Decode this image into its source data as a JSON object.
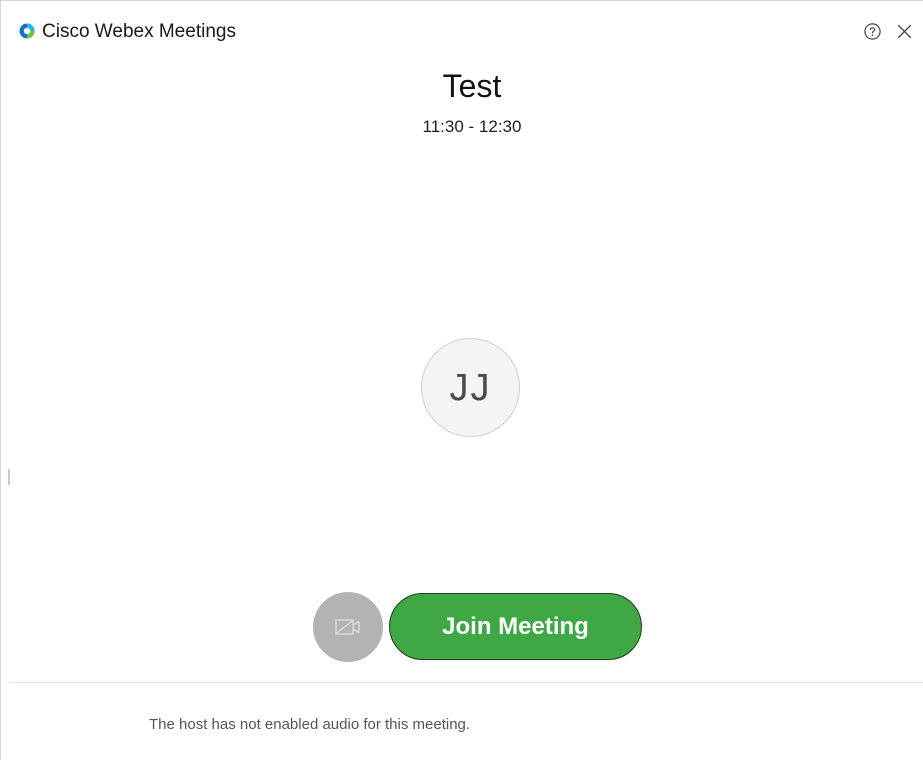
{
  "window": {
    "title": "Cisco Webex Meetings",
    "logo_icon": "webex-logo-icon",
    "help_icon": "help-circle-icon",
    "close_icon": "close-icon"
  },
  "meeting": {
    "title": "Test",
    "time": "11:30 - 12:30"
  },
  "avatar": {
    "initials": "JJ"
  },
  "controls": {
    "video_icon": "video-camera-off-icon",
    "join_label": "Join Meeting"
  },
  "footer": {
    "notice": "The host has not enabled audio for this meeting."
  },
  "colors": {
    "join_green": "#3fa845",
    "video_disabled_gray": "#b3b3b3",
    "logo_blue": "#1572c4",
    "logo_green": "#6cc24a"
  }
}
